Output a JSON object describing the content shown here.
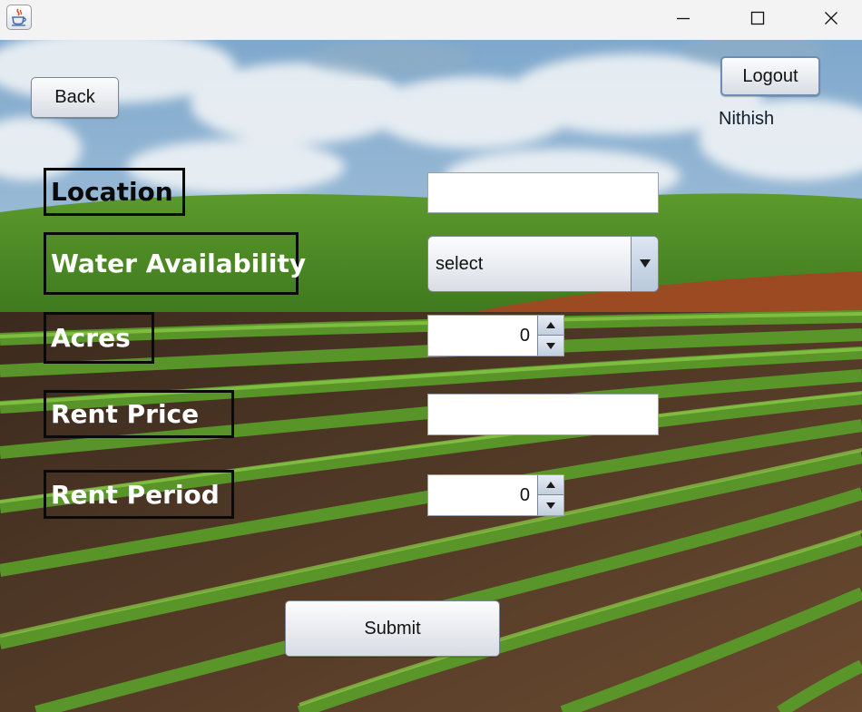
{
  "window": {
    "controls": {
      "minimize_icon": "minimize-icon",
      "maximize_icon": "maximize-icon",
      "close_icon": "close-icon"
    },
    "app_icon": "java-coffee-cup-icon"
  },
  "header": {
    "back_label": "Back",
    "logout_label": "Logout",
    "username": "Nithish"
  },
  "form": {
    "location": {
      "label": "Location",
      "value": ""
    },
    "water_availability": {
      "label": "Water Availability",
      "selected": "select",
      "arrow_icon": "dropdown-arrow-icon"
    },
    "acres": {
      "label": "Acres",
      "value": "0"
    },
    "rent_price": {
      "label": "Rent Price",
      "value": ""
    },
    "rent_period": {
      "label": "Rent Period",
      "value": "0"
    },
    "submit_label": "Submit"
  },
  "colors": {
    "label_border": "#0a0a0a",
    "button_border": "#7d8793",
    "focus_border": "#6f8db3",
    "sky": "#9dbcd6",
    "field_green": "#4d8a2c",
    "soil": "#5a3a24"
  }
}
